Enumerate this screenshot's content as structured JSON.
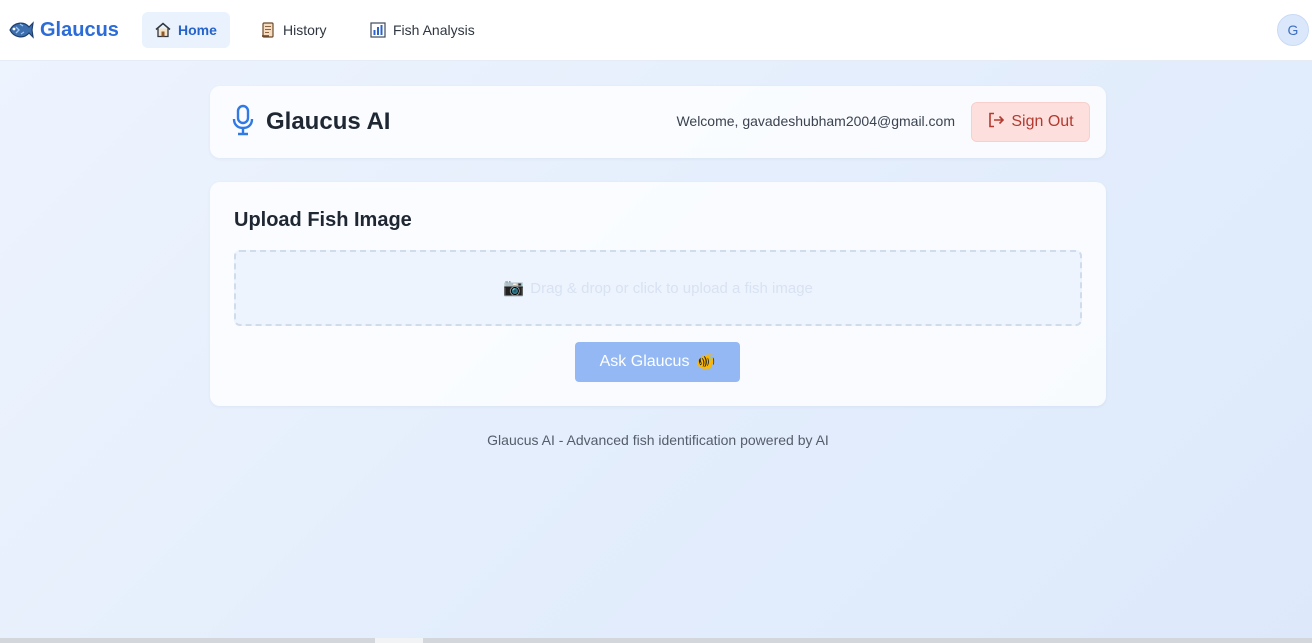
{
  "nav": {
    "brand": "Glaucus",
    "brand_icon": "fish-icon",
    "links": [
      {
        "label": "Home",
        "icon": "home-icon",
        "active": true
      },
      {
        "label": "History",
        "icon": "scroll-icon",
        "active": false
      },
      {
        "label": "Fish Analysis",
        "icon": "bar-chart-icon",
        "active": false
      }
    ],
    "avatar_initial": "G"
  },
  "header": {
    "title": "Glaucus AI",
    "icon": "microphone-icon",
    "welcome": "Welcome, gavadeshubham2004@gmail.com",
    "signout_label": "Sign Out"
  },
  "upload": {
    "title": "Upload Fish Image",
    "dropzone_icon": "📷",
    "dropzone_text": "Drag & drop or click to upload a fish image",
    "ask_label": "Ask Glaucus",
    "ask_icon": "🐠"
  },
  "footer": {
    "text": "Glaucus AI - Advanced fish identification powered by AI"
  },
  "colors": {
    "accent": "#2b6cd8",
    "signout_bg": "#fde0de",
    "signout_text": "#b33a2e",
    "ask_button_bg": "#93b8f3"
  }
}
